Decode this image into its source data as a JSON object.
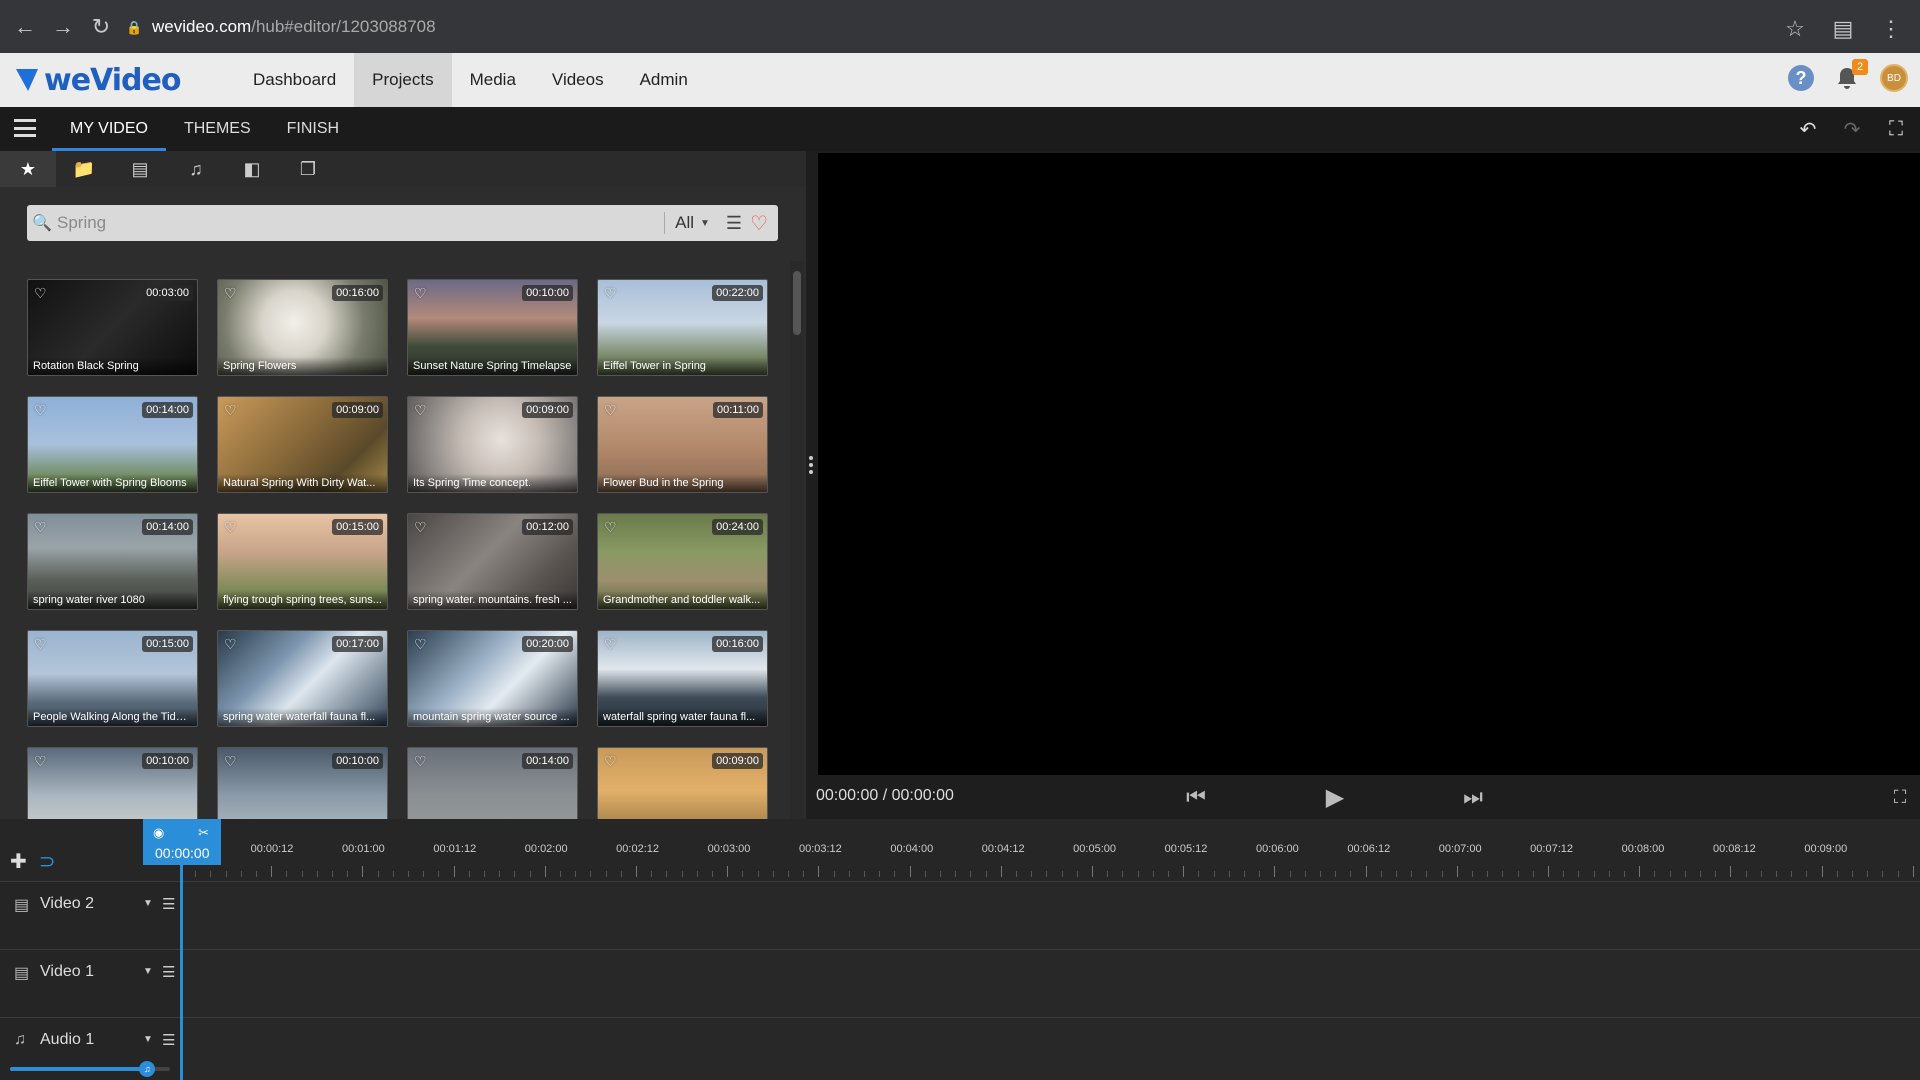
{
  "browser": {
    "url_host": "wevideo.com",
    "url_path": "/hub#editor/1203088708"
  },
  "app": {
    "logo_text": "weVideo",
    "nav": [
      {
        "label": "Dashboard",
        "active": false
      },
      {
        "label": "Projects",
        "active": true
      },
      {
        "label": "Media",
        "active": false
      },
      {
        "label": "Videos",
        "active": false
      },
      {
        "label": "Admin",
        "active": false
      }
    ],
    "notification_count": "2",
    "avatar_initials": "BD"
  },
  "editor": {
    "tabs": [
      {
        "label": "MY VIDEO",
        "active": true
      },
      {
        "label": "THEMES",
        "active": false
      },
      {
        "label": "FINISH",
        "active": false
      }
    ]
  },
  "search": {
    "value": "",
    "placeholder": "Spring",
    "filter": "All"
  },
  "media": [
    {
      "title": "Rotation Black Spring",
      "duration": "00:03:00",
      "bg": "linear-gradient(135deg,#111 0%,#2a2a2a 50%,#0c0c0c 100%)"
    },
    {
      "title": "Spring Flowers",
      "duration": "00:16:00",
      "bg": "radial-gradient(circle at 45% 45%,#f2f0ea 0%,#d8d4cb 30%,#7a7d6d 65%,#4a5040 100%)"
    },
    {
      "title": "Sunset Nature Spring Timelapse",
      "duration": "00:10:00",
      "bg": "linear-gradient(180deg,#6b6a86 0%,#b38a7a 40%,#3f4a3a 70%,#2e3328 100%)"
    },
    {
      "title": "Eiffel Tower in Spring",
      "duration": "00:22:00",
      "bg": "linear-gradient(180deg,#a9bfd8 0%,#c9d6e3 45%,#7a8a6a 80%,#5b6b4b 100%)"
    },
    {
      "title": "Eiffel Tower with Spring Blooms",
      "duration": "00:14:00",
      "bg": "linear-gradient(180deg,#8fb0d8 0%,#a8c0dc 50%,#6f8a5e 85%,#4d6640 100%)"
    },
    {
      "title": "Natural Spring With Dirty Wat...",
      "duration": "00:09:00",
      "bg": "linear-gradient(135deg,#c99a5a 0%,#8a6a3a 45%,#5a4a2a 75%,#a88a4a 100%)"
    },
    {
      "title": "Its Spring Time concept.",
      "duration": "00:09:00",
      "bg": "radial-gradient(circle at 55% 45%,#e8e2dc 0%,#c6bdb6 35%,#8c8784 70%,#5a5654 100%)"
    },
    {
      "title": "Flower Bud in the Spring",
      "duration": "00:11:00",
      "bg": "linear-gradient(180deg,#c8a488 0%,#b58a6c 50%,#8a6a52 100%)"
    },
    {
      "title": "spring water river 1080",
      "duration": "00:14:00",
      "bg": "linear-gradient(180deg,#7f8f9a 0%,#9aa4a8 35%,#595e58 70%,#3e423c 100%)"
    },
    {
      "title": "flying trough spring trees, suns...",
      "duration": "00:15:00",
      "bg": "linear-gradient(180deg,#e8c4a4 0%,#c8a48a 40%,#7d8a58 80%,#5d6a3c 100%)"
    },
    {
      "title": "spring water. mountains. fresh ...",
      "duration": "00:12:00",
      "bg": "linear-gradient(135deg,#4a4644 0%,#8a8480 45%,#5a5450 75%,#3a3634 100%)"
    },
    {
      "title": "Grandmother and toddler walk...",
      "duration": "00:24:00",
      "bg": "linear-gradient(180deg,#6a7a4a 0%,#8a9a64 40%,#9c8f6e 70%,#5d6a3c 100%)"
    },
    {
      "title": "People Walking Along the Tidal...",
      "duration": "00:15:00",
      "bg": "linear-gradient(180deg,#9ab4cf 0%,#b3c5d8 45%,#5a6a7a 75%,#3c4a58 100%)"
    },
    {
      "title": "spring water waterfall fauna fl...",
      "duration": "00:17:00",
      "bg": "linear-gradient(135deg,#2a3a4a 0%,#7d96ae 35%,#dde6ee 55%,#34485a 100%)"
    },
    {
      "title": "mountain spring water source ...",
      "duration": "00:20:00",
      "bg": "linear-gradient(135deg,#2c3e50 0%,#9db2c6 40%,#e4ebf1 60%,#2a3848 100%)"
    },
    {
      "title": "waterfall spring water fauna fl...",
      "duration": "00:16:00",
      "bg": "linear-gradient(180deg,#9eb4c8 0%,#e1e7ec 40%,#3e4c58 70%,#232c34 100%)"
    },
    {
      "title": "",
      "duration": "00:10:00",
      "bg": "linear-gradient(180deg,#5a6a7a 0%,#aab6c0 50%,#d8d8d0 100%)"
    },
    {
      "title": "",
      "duration": "00:10:00",
      "bg": "linear-gradient(180deg,#4a5a6a 0%,#8a9aa8 50%,#b8c0c4 100%)"
    },
    {
      "title": "",
      "duration": "00:14:00",
      "bg": "linear-gradient(180deg,#6a7078 0%,#8a9094 50%,#9c9c98 100%)"
    },
    {
      "title": "",
      "duration": "00:09:00",
      "bg": "linear-gradient(180deg,#c89a5a 0%,#e2b06a 45%,#8a6a3a 100%)"
    }
  ],
  "preview": {
    "timecode": "00:00:00 / 00:00:00"
  },
  "timeline": {
    "playhead": "00:00:00",
    "ruler": [
      "00:00:12",
      "00:01:00",
      "00:01:12",
      "00:02:00",
      "00:02:12",
      "00:03:00",
      "00:03:12",
      "00:04:00",
      "00:04:12",
      "00:05:00",
      "00:05:12",
      "00:06:00",
      "00:06:12",
      "00:07:00",
      "00:07:12",
      "00:08:00",
      "00:08:12",
      "00:09:00"
    ],
    "tracks": [
      {
        "name": "Video 2",
        "type": "video"
      },
      {
        "name": "Video 1",
        "type": "video"
      },
      {
        "name": "Audio 1",
        "type": "audio"
      }
    ],
    "audio_volume": 0.82
  }
}
